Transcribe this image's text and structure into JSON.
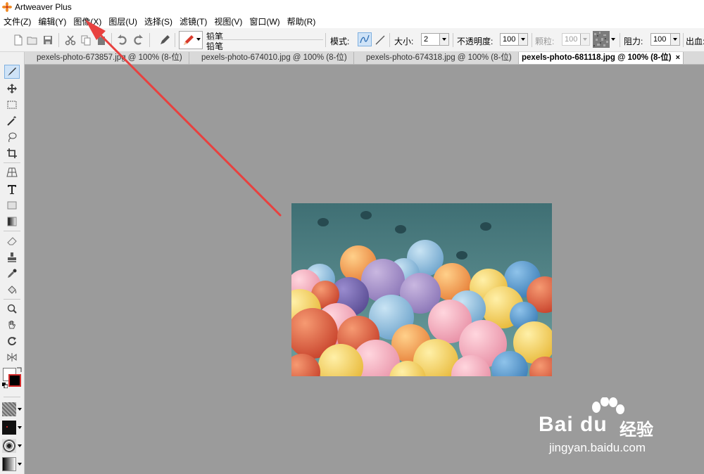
{
  "window": {
    "title": "Artweaver Plus",
    "app_icon": "artweaver-flower-icon"
  },
  "menu": [
    {
      "label": "文件(Z)"
    },
    {
      "label": "编辑(Y)"
    },
    {
      "label": "图像(X)"
    },
    {
      "label": "图层(U)"
    },
    {
      "label": "选择(S)"
    },
    {
      "label": "滤镜(T)"
    },
    {
      "label": "视图(V)"
    },
    {
      "label": "窗口(W)"
    },
    {
      "label": "帮助(R)"
    }
  ],
  "toolbar": {
    "brush_name_top": "铅笔",
    "brush_name_bottom": "铅笔",
    "mode_label": "模式:",
    "size_label": "大小:",
    "size_value": "2",
    "opacity_label": "不透明度:",
    "opacity_value": "100",
    "grain_label": "颗粒:",
    "grain_value": "100",
    "resistance_label": "阻力:",
    "resistance_value": "100",
    "bleed_label": "出血:"
  },
  "tabs": [
    {
      "label": "pexels-photo-673857.jpg @ 100% (8-位)",
      "active": false
    },
    {
      "label": "pexels-photo-674010.jpg @ 100% (8-位)",
      "active": false
    },
    {
      "label": "pexels-photo-674318.jpg @ 100% (8-位)",
      "active": false
    },
    {
      "label": "pexels-photo-681118.jpg @ 100% (8-位)",
      "active": true,
      "close": "×"
    }
  ],
  "watermark": {
    "brand": "Bai du",
    "product": "经验",
    "url": "jingyan.baidu.com"
  },
  "colors": {
    "workspace": "#9b9b9b",
    "annotation_arrow": "#e8413f",
    "foreground_color": "#000000",
    "background_color": "#ffffff"
  }
}
